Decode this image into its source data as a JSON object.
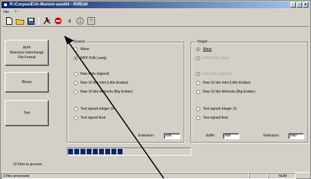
{
  "window": {
    "title": "R:\\Corpus\\EVA-Munich-aout04 - RiffEdit",
    "controls": [
      "_",
      "□",
      "✕"
    ]
  },
  "menu": {
    "items": [
      "File",
      "?"
    ]
  },
  "toolbar": {
    "icons": [
      "new-file-icon",
      "open-folder-icon",
      "save-icon",
      "run-icon",
      "stop-icon",
      "back-icon",
      "info-icon",
      "help-icon"
    ]
  },
  "left_buttons": {
    "riff": "RIFF\nResource Interchange\nFile Format",
    "binary": "Binary",
    "text": "Text"
  },
  "source": {
    "title": "Source",
    "options": {
      "wave": "Wave",
      "riff_eva": "RIFF EVA (.wsig)",
      "raw8": "Raw 8bits (signed)",
      "raw16_intel": "Raw 16 bits Intel (Little Endian)",
      "raw16_motorola": "Raw 16 bits Motorola (Big Endian)",
      "text_int16": "Text signed integer 16",
      "text_float": "Text signed float"
    },
    "extension_label": "Extension:",
    "extension_value": "wsil"
  },
  "target": {
    "title": "Target",
    "options": {
      "wave": "Wave",
      "riff_eva": "RIFF EVA (.wsig)",
      "raw8": "Raw 8bits (signed)",
      "raw16_intel": "Raw 16 bits Intel (Little Endian)",
      "raw16_motorola": "Raw 16 bits Motorola (Big Endian)",
      "text_int16": "Text signed integer 16",
      "text_float": "Text signed float"
    },
    "suffix_label": "Suffix:",
    "suffix_value": "wsil",
    "extension_label": "Extension:",
    "extension_value": "wav"
  },
  "progress": {
    "value": 0.45
  },
  "files_to_process": "10 Files to process",
  "status": {
    "left": "3 files processed",
    "num": "NUM"
  },
  "colors": {
    "titlebar": "#0a246a",
    "progress": "#0a246a",
    "face": "#d4d0c8"
  }
}
